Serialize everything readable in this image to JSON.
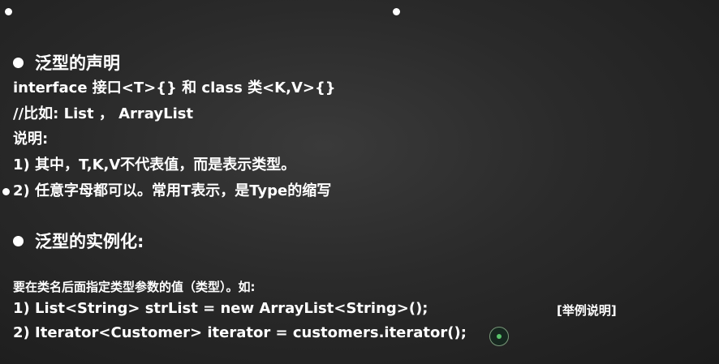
{
  "section1": {
    "heading": "泛型的声明",
    "line1": "interface 接口<T>{} 和 class 类<K,V>{}",
    "line2": "//比如: List ， ArrayList",
    "line3": "说明:",
    "line4": "1) 其中，T,K,V不代表值，而是表示类型。",
    "line5": "2) 任意字母都可以。常用T表示，是Type的缩写"
  },
  "section2": {
    "heading": "泛型的实例化:",
    "line1": "要在类名后面指定类型参数的值（类型）。如:",
    "line2": "1) List<String> strList = new ArrayList<String>();",
    "line3": "2) Iterator<Customer> iterator = customers.iterator();",
    "note": "[举例说明]"
  },
  "icons": {
    "bullet": "bullet-dot-icon",
    "cursor": "mouse-cursor-icon"
  }
}
